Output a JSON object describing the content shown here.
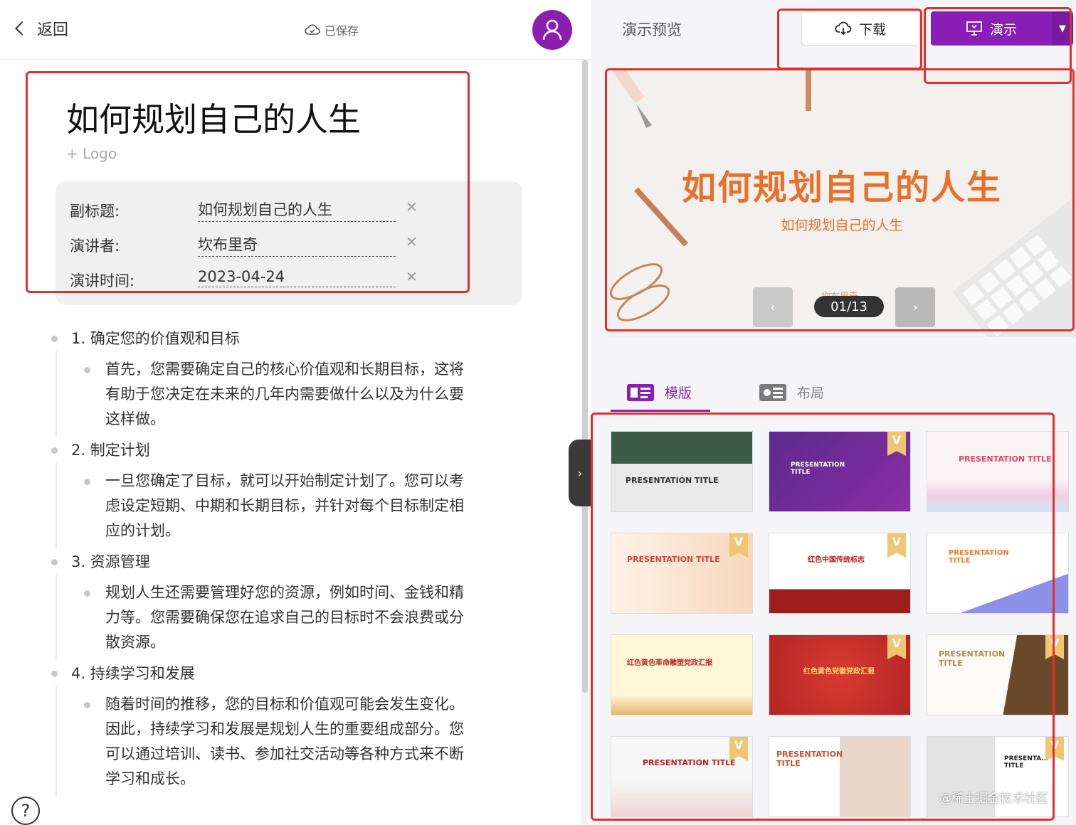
{
  "header": {
    "back_label": "返回",
    "saved_label": "已保存"
  },
  "doc": {
    "title": "如何规划自己的人生",
    "logo_add": "+ Logo",
    "meta": [
      {
        "label": "副标题:",
        "value": "如何规划自己的人生"
      },
      {
        "label": "演讲者:",
        "value": "坎布里奇"
      },
      {
        "label": "演讲时间:",
        "value": "2023-04-24"
      }
    ],
    "sections": [
      {
        "heading": "1. 确定您的价值观和目标",
        "body": [
          "首先，您需要确定自己的核心价值观和长期目标，这将",
          "有助于您决定在未来的几年内需要做什么以及为什么要",
          "这样做。"
        ]
      },
      {
        "heading": "2. 制定计划",
        "body": [
          "一旦您确定了目标，就可以开始制定计划了。您可以考",
          "虑设定短期、中期和长期目标，并针对每个目标制定相",
          "应的计划。"
        ]
      },
      {
        "heading": "3. 资源管理",
        "body": [
          "规划人生还需要管理好您的资源，例如时间、金钱和精",
          "力等。您需要确保您在追求自己的目标时不会浪费或分",
          "散资源。"
        ]
      },
      {
        "heading": "4. 持续学习和发展",
        "body": [
          "随着时间的推移，您的目标和价值观可能会发生变化。",
          "因此，持续学习和发展是规划人生的重要组成部分。您",
          "可以通过培训、读书、参加社交活动等各种方式来不断",
          "学习和成长。"
        ]
      }
    ],
    "help_label": "?"
  },
  "preview": {
    "title": "演示预览",
    "download_label": "下载",
    "present_label": "演示",
    "slide": {
      "title": "如何规划自己的人生",
      "subtitle": "如何规划自己的人生",
      "speaker": "坎布里奇",
      "counter": "01/13"
    },
    "tabs": [
      {
        "label": "模版",
        "active": true
      },
      {
        "label": "布局",
        "active": false
      }
    ],
    "templates": [
      {
        "title": "PRESENTATION TITLE",
        "vip": false
      },
      {
        "title": "PRESENTATION TITLE",
        "vip": true
      },
      {
        "title": "PRESENTATION TITLE",
        "vip": false
      },
      {
        "title": "PRESENTATION TITLE",
        "vip": true
      },
      {
        "title": "红色中国传统标志",
        "vip": true
      },
      {
        "title": "PRESENTATION TITLE",
        "vip": false
      },
      {
        "title": "红色黄色革命雕塑党政汇报",
        "vip": false
      },
      {
        "title": "红色黄色党徽党政汇报",
        "vip": true
      },
      {
        "title": "PRESENTATION TITLE",
        "vip": true
      },
      {
        "title": "PRESENTATION TITLE",
        "vip": true
      },
      {
        "title": "PRESENTATION TITLE",
        "vip": false
      },
      {
        "title": "PRESENTA... TITLE",
        "vip": true
      }
    ],
    "watermark": "@稀土掘金技术社区"
  },
  "colors": {
    "accent": "#8a1fb5",
    "slide_text": "#e8702a",
    "highlight": "#e0302e"
  }
}
